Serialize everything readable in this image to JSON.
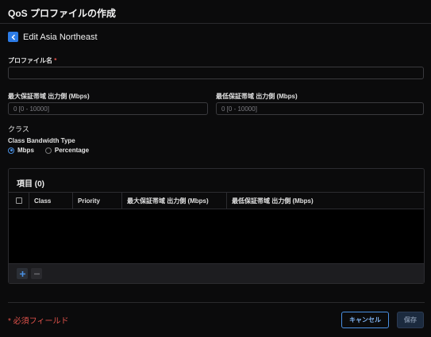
{
  "header": {
    "title": "QoS プロファイルの作成"
  },
  "edit": {
    "title": "Edit Asia Northeast"
  },
  "form": {
    "profile_name_label": "プロファイル名",
    "required_mark": "*",
    "profile_name_value": "",
    "max_bw_label": "最大保証帯域 出力側 (Mbps)",
    "max_bw_placeholder": "0 [0 - 10000]",
    "min_bw_label": "最低保証帯域 出力側 (Mbps)",
    "min_bw_placeholder": "0 [0 - 10000]",
    "class_section": "クラス",
    "class_bw_type_label": "Class Bandwidth Type",
    "bw_type_options": [
      "Mbps",
      "Percentage"
    ],
    "bw_type_selected": "Mbps"
  },
  "table": {
    "title": "項目 (0)",
    "columns": [
      "Class",
      "Priority",
      "最大保証帯域 出力側 (Mbps)",
      "最低保証帯域 出力側 (Mbps)"
    ],
    "rows": []
  },
  "footer": {
    "required_note": "* 必須フィールド",
    "cancel_label": "キャンセル",
    "save_label": "保存"
  },
  "colors": {
    "accent": "#2c7be5",
    "required": "#e0524b",
    "background": "#0b0b0c"
  },
  "icons": [
    "back-arrow-icon",
    "plus-icon",
    "minus-icon"
  ]
}
